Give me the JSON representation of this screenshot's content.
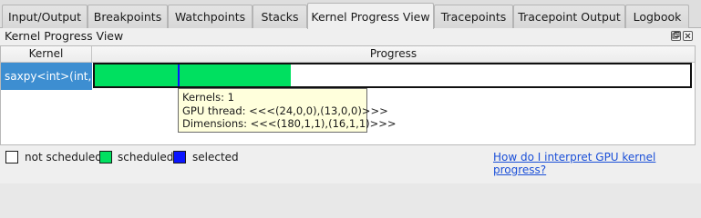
{
  "tabs": [
    {
      "label": "Input/Output"
    },
    {
      "label": "Breakpoints"
    },
    {
      "label": "Watchpoints"
    },
    {
      "label": "Stacks"
    },
    {
      "label": "Kernel Progress View",
      "active": true
    },
    {
      "label": "Tracepoints"
    },
    {
      "label": "Tracepoint Output"
    },
    {
      "label": "Logbook"
    }
  ],
  "panel": {
    "title": "Kernel Progress View",
    "float_icon": "float-window-icon",
    "close_icon": "close-icon"
  },
  "table": {
    "columns": [
      "Kernel",
      "Progress"
    ],
    "rows": [
      {
        "kernel": "saxpy<int>(int, ...",
        "progress": {
          "scheduled_fraction": 0.33,
          "selected_marker_fraction": 0.14
        }
      }
    ]
  },
  "tooltip": {
    "line1": "Kernels: 1",
    "line2": "GPU thread: <<<(24,0,0),(13,0,0)>>>",
    "line3": "Dimensions: <<<(180,1,1),(16,1,1)>>>"
  },
  "legend": {
    "not_scheduled": "not scheduled",
    "scheduled": "scheduled",
    "selected": "selected"
  },
  "help_link": "How do I interpret GPU kernel progress?",
  "colors": {
    "not_scheduled": "#ffffff",
    "scheduled": "#00e060",
    "selected": "#0a14ff",
    "row_selection": "#3d8ed1"
  }
}
